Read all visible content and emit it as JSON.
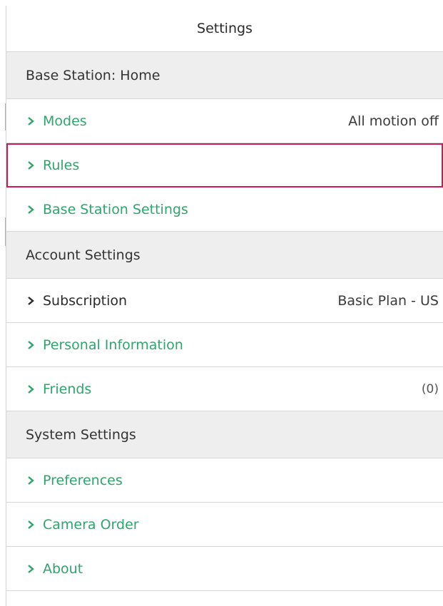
{
  "header": {
    "title": "Settings"
  },
  "sections": [
    {
      "title": "Base Station: Home",
      "items": [
        {
          "label": "Modes",
          "value": "All motion off"
        },
        {
          "label": "Rules",
          "value": ""
        },
        {
          "label": "Base Station Settings",
          "value": ""
        }
      ]
    },
    {
      "title": "Account Settings",
      "items": [
        {
          "label": "Subscription",
          "value": "Basic Plan - US"
        },
        {
          "label": "Personal Information",
          "value": ""
        },
        {
          "label": "Friends",
          "value": "(0)"
        }
      ]
    },
    {
      "title": "System Settings",
      "items": [
        {
          "label": "Preferences",
          "value": ""
        },
        {
          "label": "Camera Order",
          "value": ""
        },
        {
          "label": "About",
          "value": ""
        }
      ]
    }
  ],
  "icons": {
    "row_arrow": "chevron-right-icon"
  },
  "colors": {
    "link_green": "#2fa56b",
    "highlight": "#cc1a55",
    "section_bg": "#eeeeee"
  }
}
